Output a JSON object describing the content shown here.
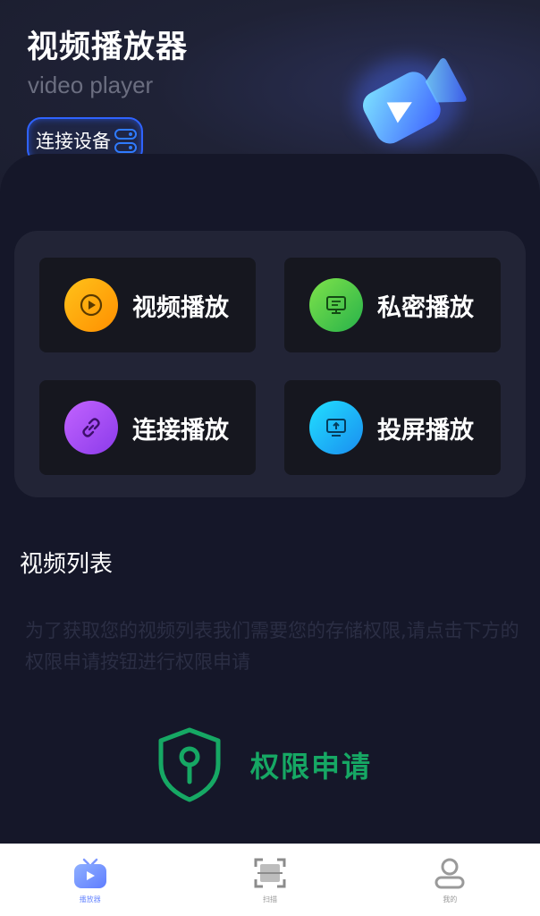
{
  "header": {
    "title": "视频播放器",
    "subtitle": "video player",
    "connect_button_label": "连接设备"
  },
  "actions": [
    {
      "label": "视频播放",
      "icon": "play-circle-icon",
      "color": "#ffb300"
    },
    {
      "label": "私密播放",
      "icon": "private-screen-icon",
      "color": "#4cc84a"
    },
    {
      "label": "连接播放",
      "icon": "link-icon",
      "color": "#a64cf5"
    },
    {
      "label": "投屏播放",
      "icon": "screen-cast-icon",
      "color": "#1fb6f7"
    }
  ],
  "video_list": {
    "title": "视频列表",
    "notice": "为了获取您的视频列表我们需要您的存储权限,请点击下方的权限申请按钮进行权限申请"
  },
  "permission_button": {
    "label": "权限申请",
    "color": "#16a864"
  },
  "tabbar": {
    "items": [
      {
        "label": "播放器",
        "icon": "tv-icon",
        "active": true
      },
      {
        "label": "扫描",
        "icon": "scan-icon",
        "active": false
      },
      {
        "label": "我的",
        "icon": "profile-icon",
        "active": false
      }
    ]
  },
  "colors": {
    "background": "#151729",
    "card": "#222436",
    "tile": "#16171f",
    "accent_blue": "#2f63ff"
  }
}
